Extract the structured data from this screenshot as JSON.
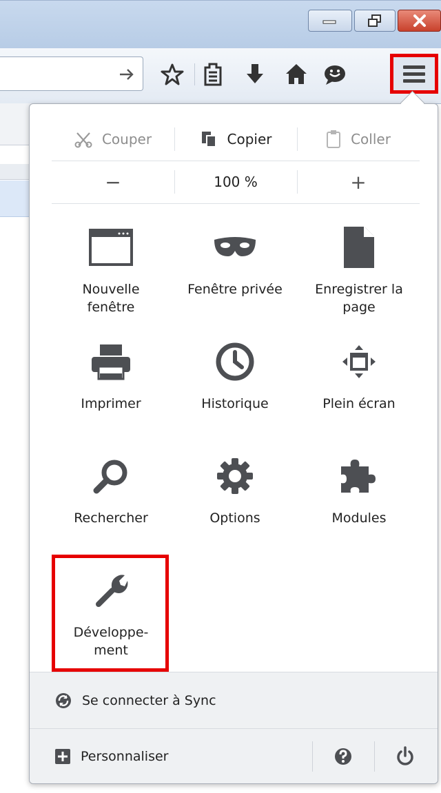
{
  "menu": {
    "edit": {
      "cut": "Couper",
      "copy": "Copier",
      "paste": "Coller"
    },
    "zoom": {
      "out": "−",
      "level": "100 %",
      "in": "+"
    },
    "items": [
      {
        "label1": "Nouvelle",
        "label2": "fenêtre",
        "icon": "new-window-icon"
      },
      {
        "label1": "Fenêtre privée",
        "label2": "",
        "icon": "private-mask-icon"
      },
      {
        "label1": "Enregistrer la",
        "label2": "page",
        "icon": "save-page-icon"
      },
      {
        "label1": "Imprimer",
        "label2": "",
        "icon": "printer-icon"
      },
      {
        "label1": "Historique",
        "label2": "",
        "icon": "history-clock-icon"
      },
      {
        "label1": "Plein écran",
        "label2": "",
        "icon": "fullscreen-icon"
      },
      {
        "label1": "Rechercher",
        "label2": "",
        "icon": "search-icon"
      },
      {
        "label1": "Options",
        "label2": "",
        "icon": "gear-icon"
      },
      {
        "label1": "Modules",
        "label2": "",
        "icon": "puzzle-icon"
      },
      {
        "label1": "Développe-",
        "label2": "ment",
        "icon": "wrench-icon"
      }
    ],
    "sync": "Se connecter à Sync",
    "customize": "Personnaliser"
  },
  "colors": {
    "highlight": "#e60000",
    "icon": "#4d4f53"
  }
}
